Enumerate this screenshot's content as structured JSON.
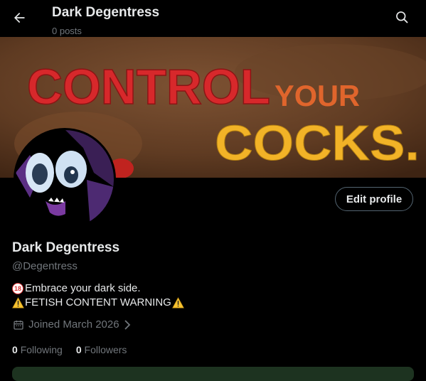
{
  "header": {
    "title": "Dark Degentress",
    "subtitle": "0 posts",
    "back_icon": "arrow-left-icon",
    "search_icon": "search-icon"
  },
  "banner": {
    "line1_word1": "CONTROL",
    "line1_word2": "YOUR",
    "line2": "COCKS.",
    "colors": {
      "red": "#d7282b",
      "yellow": "#f2b327",
      "bg": "#6e4529"
    }
  },
  "profile": {
    "edit_label": "Edit profile",
    "name": "Dark Degentress",
    "handle": "@Degentress",
    "bio_line1": "Embrace your dark side.",
    "bio_line1_badge": "18",
    "bio_line2": "FETISH CONTENT WARNING",
    "joined": "Joined March 2026",
    "following_count": "0",
    "following_label": "Following",
    "followers_count": "0",
    "followers_label": "Followers"
  },
  "colors": {
    "text": "#e7e9ea",
    "muted": "#71767b",
    "border": "#536471",
    "background": "#000000"
  }
}
